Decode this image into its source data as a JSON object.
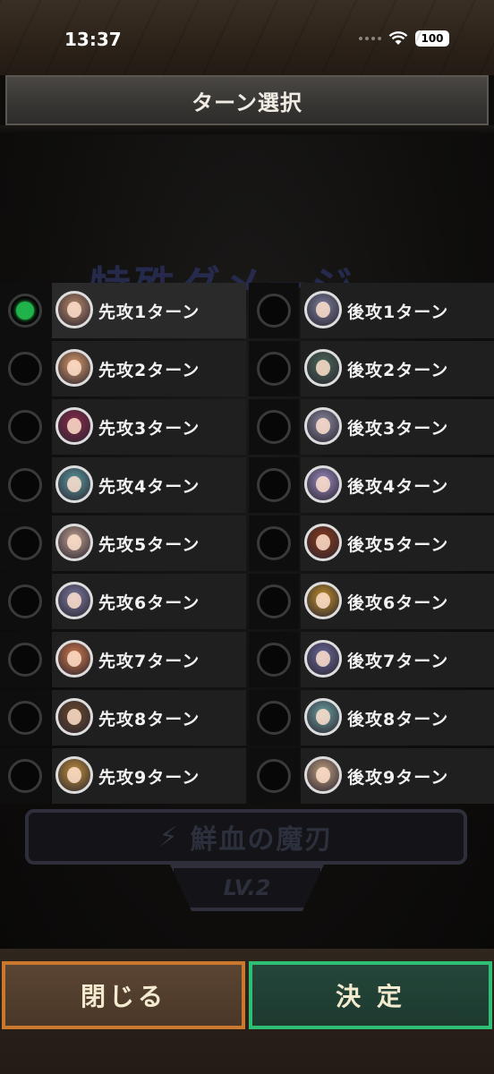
{
  "status": {
    "time": "13:37",
    "battery": "100"
  },
  "header": {
    "title": "ターン選択"
  },
  "background": {
    "heading": "特殊ダメージ",
    "skill_name": "鮮血の魔刃",
    "level": "LV.2"
  },
  "rows": [
    {
      "left": {
        "label": "先攻1ターン",
        "selected": true,
        "avatar_color": "#b98a6a"
      },
      "right": {
        "label": "後攻1ターン",
        "selected": false,
        "avatar_color": "#7a7f9a"
      }
    },
    {
      "left": {
        "label": "先攻2ターン",
        "selected": false,
        "avatar_color": "#d99a6a"
      },
      "right": {
        "label": "後攻2ターン",
        "selected": false,
        "avatar_color": "#4a6a5a"
      }
    },
    {
      "left": {
        "label": "先攻3ターン",
        "selected": false,
        "avatar_color": "#8a2a4a"
      },
      "right": {
        "label": "後攻3ターン",
        "selected": false,
        "avatar_color": "#8a8aa0"
      }
    },
    {
      "left": {
        "label": "先攻4ターン",
        "selected": false,
        "avatar_color": "#5a9aa0"
      },
      "right": {
        "label": "後攻4ターン",
        "selected": false,
        "avatar_color": "#9a8ac0"
      }
    },
    {
      "left": {
        "label": "先攻5ターン",
        "selected": false,
        "avatar_color": "#c0a090"
      },
      "right": {
        "label": "後攻5ターン",
        "selected": false,
        "avatar_color": "#8a3a1a"
      }
    },
    {
      "left": {
        "label": "先攻6ターン",
        "selected": false,
        "avatar_color": "#7a7aa0"
      },
      "right": {
        "label": "後攻6ターン",
        "selected": false,
        "avatar_color": "#c0902a"
      }
    },
    {
      "left": {
        "label": "先攻7ターン",
        "selected": false,
        "avatar_color": "#d07a4a"
      },
      "right": {
        "label": "後攻7ターン",
        "selected": false,
        "avatar_color": "#6a6a9a"
      }
    },
    {
      "left": {
        "label": "先攻8ターン",
        "selected": false,
        "avatar_color": "#6a4a2a"
      },
      "right": {
        "label": "後攻8ターン",
        "selected": false,
        "avatar_color": "#6aa0a0"
      }
    },
    {
      "left": {
        "label": "先攻9ターン",
        "selected": false,
        "avatar_color": "#c0903a"
      },
      "right": {
        "label": "後攻9ターン",
        "selected": false,
        "avatar_color": "#c0a080"
      }
    }
  ],
  "buttons": {
    "close_label": "閉じる",
    "confirm_label": "決 定"
  },
  "colors": {
    "radio_selected": "#1fb34a",
    "close_border": "#c9782e",
    "confirm_border": "#2fbf74"
  }
}
